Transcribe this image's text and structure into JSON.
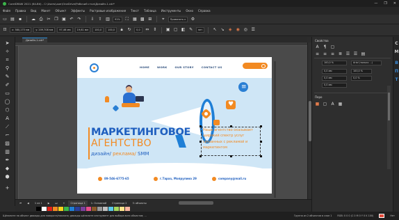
{
  "window": {
    "title": "CorelDRAW 2021 (64-Bit) - C:\\Users\\user\\OneDrive\\Рабочий стол\\Дизайн-1.cdr*",
    "controls": [
      "—",
      "❐",
      "✕"
    ]
  },
  "menu": [
    "Файл",
    "Правка",
    "Вид",
    "Макет",
    "Объект",
    "Эффекты",
    "Растровые изображения",
    "Текст",
    "Таблица",
    "Инструменты",
    "Окно",
    "Справка"
  ],
  "toolbar1": {
    "zoom": "91%",
    "snap_label": "Привязать к"
  },
  "toolbar2": {
    "pos_x": "x: 380,175 мм",
    "pos_y": "y: 209,708 мм",
    "width": "97,46 мм",
    "height": "19,61 мм",
    "scale_x": "100,0",
    "scale_y": "100,0",
    "angle": "0,0",
    "outline": "нет"
  },
  "document_tab": "Дизайн-1.cdr*",
  "design": {
    "nav": [
      "HOME",
      "WORK",
      "OUR STORY",
      "CONTACT US"
    ],
    "headline": "МАРКЕТИНГОВОЕ",
    "headline2": "АГЕНТСТВО",
    "services_part1": "дизайн/",
    "services_part2": " реклама/",
    "services_part3": " SMM",
    "description": "Наше агентство оказывает\nширокий спектр услуг\nсвязанных с рекламой и\nмаркетингом",
    "phone": "89-546-6775-65",
    "address": "г.Тараз, Мопрулина 29",
    "email": "company@mail.ru"
  },
  "pagebar": {
    "page_info": "1 из 1",
    "tabs": [
      "Страница 1",
      "1: Основной",
      "Страница 2",
      "3: объекты"
    ]
  },
  "palette": [
    "#000000",
    "#ffffff",
    "#e2231a",
    "#f28a22",
    "#f5d31c",
    "#3bb54a",
    "#1f7fd6",
    "#2a3f9c",
    "#7a3f9c",
    "#e84d8a",
    "#8a5a2b",
    "#9a9a9a",
    "#c0c0c0",
    "#5ac8e8",
    "#a4d65e",
    "#fde28a",
    "#f9b4a0"
  ],
  "status": {
    "left": "Щёлкните на объект дважды для поворота/наклона; дважды щёлкните инструмент для выбора всех объектов; ...",
    "mid": "Группа из 2 объектов в слое 1",
    "color_profile": "RGB: 0 0 0 (C 0 M 0 Y 0 K 100)",
    "fill": "Нет"
  },
  "right_panel": {
    "section1": "Свойства",
    "width_field": "100,0 %",
    "font_field": "Arial (только ...)",
    "size_fields": [
      "0,0 мм",
      "0,0 мм",
      "0,0 мм"
    ],
    "pct_fields": [
      "100,0 %",
      "0,0 %"
    ],
    "section2": "Перо"
  },
  "dock_tabs": [
    "С",
    "М",
    "В",
    "П",
    "Т"
  ]
}
